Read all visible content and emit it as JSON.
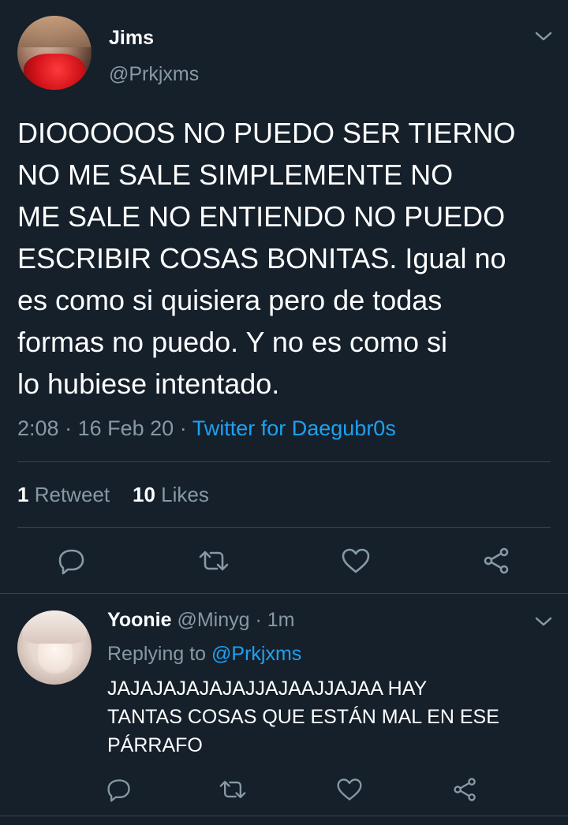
{
  "tweet": {
    "author_name": "Jims",
    "author_handle": "@Prkjxms",
    "text": "DIOOOOOS NO PUEDO SER TIERNO\nNO ME SALE SIMPLEMENTE NO\nME SALE NO ENTIENDO NO PUEDO\nESCRIBIR COSAS BONITAS. Igual no\nes como si quisiera pero de todas\nformas no puedo. Y no es como si\nlo hubiese intentado.",
    "time": "2:08",
    "date": "16 Feb 20",
    "sep": "·",
    "source": "Twitter for Daegubr0s",
    "retweet_count": "1",
    "retweet_label": "Retweet",
    "likes_count": "10",
    "likes_label": "Likes",
    "icons": [
      "reply-icon",
      "retweet-icon",
      "like-icon",
      "share-icon"
    ]
  },
  "reply": {
    "author_name": "Yoonie",
    "author_handle": "@Minyg",
    "sep": "·",
    "time_ago": "1m",
    "replying_label": "Replying to",
    "replying_handle": "@Prkjxms",
    "text": "JAJAJAJAJAJAJJAJAAJJAJAA HAY\nTANTAS COSAS QUE ESTÁN MAL EN ESE\nPÁRRAFO",
    "icons": [
      "reply-icon",
      "retweet-icon",
      "like-icon",
      "share-icon"
    ]
  },
  "colors": {
    "background": "#15202b",
    "text": "#ffffff",
    "muted": "#8899a6",
    "link": "#1da1f2",
    "divider": "#38444d"
  }
}
